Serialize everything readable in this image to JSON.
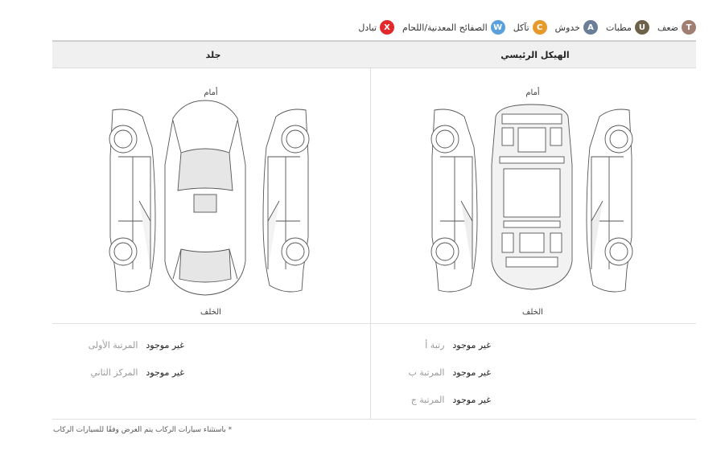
{
  "legend": [
    {
      "code": "T",
      "label": "ضعف",
      "color": "#a07f72"
    },
    {
      "code": "U",
      "label": "مطبات",
      "color": "#6d6249"
    },
    {
      "code": "A",
      "label": "خدوش",
      "color": "#6a7e98"
    },
    {
      "code": "C",
      "label": "تآكل",
      "color": "#e79a2c"
    },
    {
      "code": "W",
      "label": "الصفائح المعدنية/اللحام",
      "color": "#5aa0dc"
    },
    {
      "code": "X",
      "label": "تبادل",
      "color": "#e2282b"
    }
  ],
  "columns": {
    "main_frame": "الهيكل الرئيسي",
    "skin": "جلد"
  },
  "diagram": {
    "front": "أمام",
    "rear": "الخلف"
  },
  "main_frame_items": [
    {
      "label": "رتبة أ",
      "value": "غير موجود"
    },
    {
      "label": "المرتبة ب",
      "value": "غير موجود"
    },
    {
      "label": "المرتبة ج",
      "value": "غير موجود"
    }
  ],
  "skin_items": [
    {
      "label": "المرتبة الأولى",
      "value": "غير موجود"
    },
    {
      "label": "المركز الثاني",
      "value": "غير موجود"
    }
  ],
  "footnote": "* باستثناء سيارات الركاب يتم العرض وفقًا للسيارات الركاب"
}
